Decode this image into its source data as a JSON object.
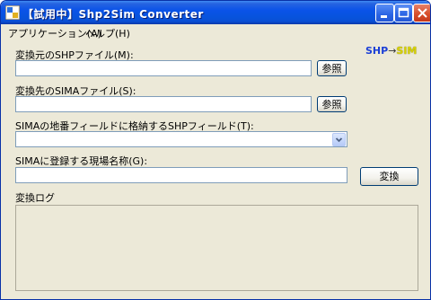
{
  "window": {
    "title": "【試用中】Shp2Sim Converter",
    "logo_left": "SHP",
    "logo_arrow": "→",
    "logo_right": "SIM"
  },
  "menu": [
    {
      "label": "アプリケーション(A)"
    },
    {
      "label": "ヘルプ(H)"
    }
  ],
  "form": {
    "shp_label": "変換元のSHPファイル(M):",
    "shp_value": "",
    "shp_browse": "参照",
    "sima_label": "変換先のSIMAファイル(S):",
    "sima_value": "",
    "sima_browse": "参照",
    "field_label": "SIMAの地番フィールドに格納するSHPフィールド(T):",
    "field_selected": "",
    "site_label": "SIMAに登録する現場名称(G):",
    "site_value": "",
    "convert_button": "変換",
    "log_label": "変換ログ",
    "log_text": ""
  },
  "colors": {
    "titlebar": "#0a53e8",
    "window_bg": "#ece9d8",
    "field_border": "#7f9db9"
  }
}
